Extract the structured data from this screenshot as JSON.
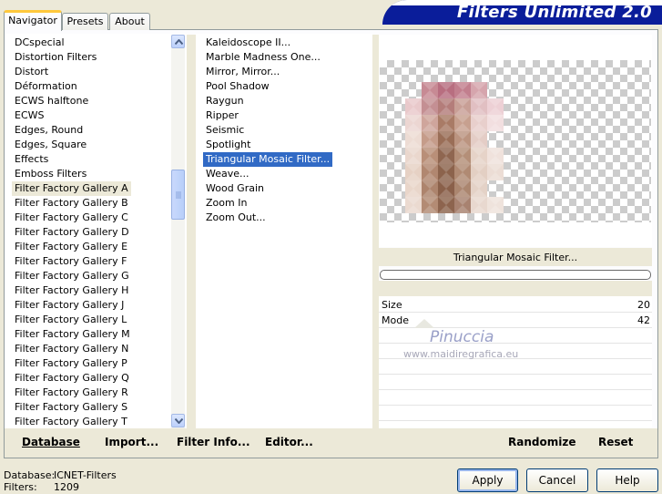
{
  "tabs": [
    "Navigator",
    "Presets",
    "About"
  ],
  "banner": "Filters Unlimited 2.0",
  "categories": [
    "DCspecial",
    "Distortion Filters",
    "Distort",
    "Déformation",
    "ECWS halftone",
    "ECWS",
    "Edges, Round",
    "Edges, Square",
    "Effects",
    "Emboss Filters",
    "Filter Factory Gallery A",
    "Filter Factory Gallery B",
    "Filter Factory Gallery C",
    "Filter Factory Gallery D",
    "Filter Factory Gallery E",
    "Filter Factory Gallery F",
    "Filter Factory Gallery G",
    "Filter Factory Gallery H",
    "Filter Factory Gallery J",
    "Filter Factory Gallery L",
    "Filter Factory Gallery M",
    "Filter Factory Gallery N",
    "Filter Factory Gallery P",
    "Filter Factory Gallery Q",
    "Filter Factory Gallery R",
    "Filter Factory Gallery S",
    "Filter Factory Gallery T"
  ],
  "selected_category": "Filter Factory Gallery A",
  "filters": [
    "Kaleidoscope II...",
    "Marble Madness One...",
    "Mirror, Mirror...",
    "Pool Shadow",
    "Raygun",
    "Ripper",
    "Seismic",
    "Spotlight",
    "Triangular Mosaic Filter...",
    "Weave...",
    "Wood Grain",
    "Zoom In",
    "Zoom Out..."
  ],
  "selected_filter": "Triangular Mosaic Filter...",
  "preview": {
    "filter_name": "Triangular Mosaic Filter...",
    "progress": 0
  },
  "params": [
    {
      "label": "Size",
      "value": "20"
    },
    {
      "label": "Mode",
      "value": "42"
    }
  ],
  "watermark": {
    "name": "Pinuccia",
    "site": "www.maidiregrafica.eu"
  },
  "bottom_links": {
    "database": "Database",
    "import": "Import...",
    "filter_info": "Filter Info...",
    "editor": "Editor...",
    "randomize": "Randomize",
    "reset": "Reset"
  },
  "status": {
    "database_label": "Database:",
    "database_value": "ICNET-Filters",
    "filters_label": "Filters:",
    "filters_value": "1209"
  },
  "buttons": {
    "apply": "Apply",
    "cancel": "Cancel",
    "help": "Help"
  },
  "colors": {
    "banner": "#0a1d9a",
    "selection": "#316ac5",
    "tab_highlight": "#ffc83c"
  }
}
